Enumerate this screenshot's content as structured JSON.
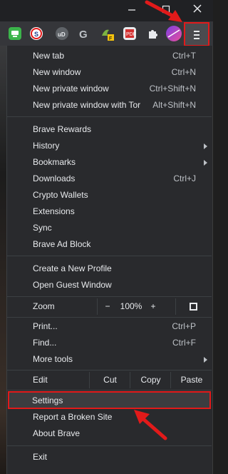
{
  "window": {
    "minimize_icon": "minimize-icon",
    "maximize_icon": "maximize-icon",
    "close_icon": "close-icon"
  },
  "toolbar": {
    "extensions": [
      "extension-green",
      "extension-sync",
      "extension-ublock",
      "extension-grammarly",
      "extension-vpn",
      "extension-pdf",
      "extensions-puzzle"
    ],
    "menu_icon": "hamburger-menu-icon"
  },
  "menu": {
    "group1": [
      {
        "label": "New tab",
        "shortcut": "Ctrl+T"
      },
      {
        "label": "New window",
        "shortcut": "Ctrl+N"
      },
      {
        "label": "New private window",
        "shortcut": "Ctrl+Shift+N"
      },
      {
        "label": "New private window with Tor",
        "shortcut": "Alt+Shift+N"
      }
    ],
    "group2": [
      {
        "label": "Brave Rewards"
      },
      {
        "label": "History",
        "submenu": true
      },
      {
        "label": "Bookmarks",
        "submenu": true
      },
      {
        "label": "Downloads",
        "shortcut": "Ctrl+J"
      },
      {
        "label": "Crypto Wallets"
      },
      {
        "label": "Extensions"
      },
      {
        "label": "Sync"
      },
      {
        "label": "Brave Ad Block"
      }
    ],
    "group3": [
      {
        "label": "Create a New Profile"
      },
      {
        "label": "Open Guest Window"
      }
    ],
    "zoom": {
      "label": "Zoom",
      "minus": "−",
      "value": "100%",
      "plus": "+"
    },
    "group4": [
      {
        "label": "Print...",
        "shortcut": "Ctrl+P"
      },
      {
        "label": "Find...",
        "shortcut": "Ctrl+F"
      },
      {
        "label": "More tools",
        "submenu": true
      }
    ],
    "edit": {
      "label": "Edit",
      "cut": "Cut",
      "copy": "Copy",
      "paste": "Paste"
    },
    "group5": [
      {
        "label": "Settings"
      },
      {
        "label": "Report a Broken Site"
      },
      {
        "label": "About Brave"
      }
    ],
    "exit": {
      "label": "Exit"
    }
  },
  "colors": {
    "highlight": "#e21a1a",
    "menu_bg": "#292a2d"
  }
}
